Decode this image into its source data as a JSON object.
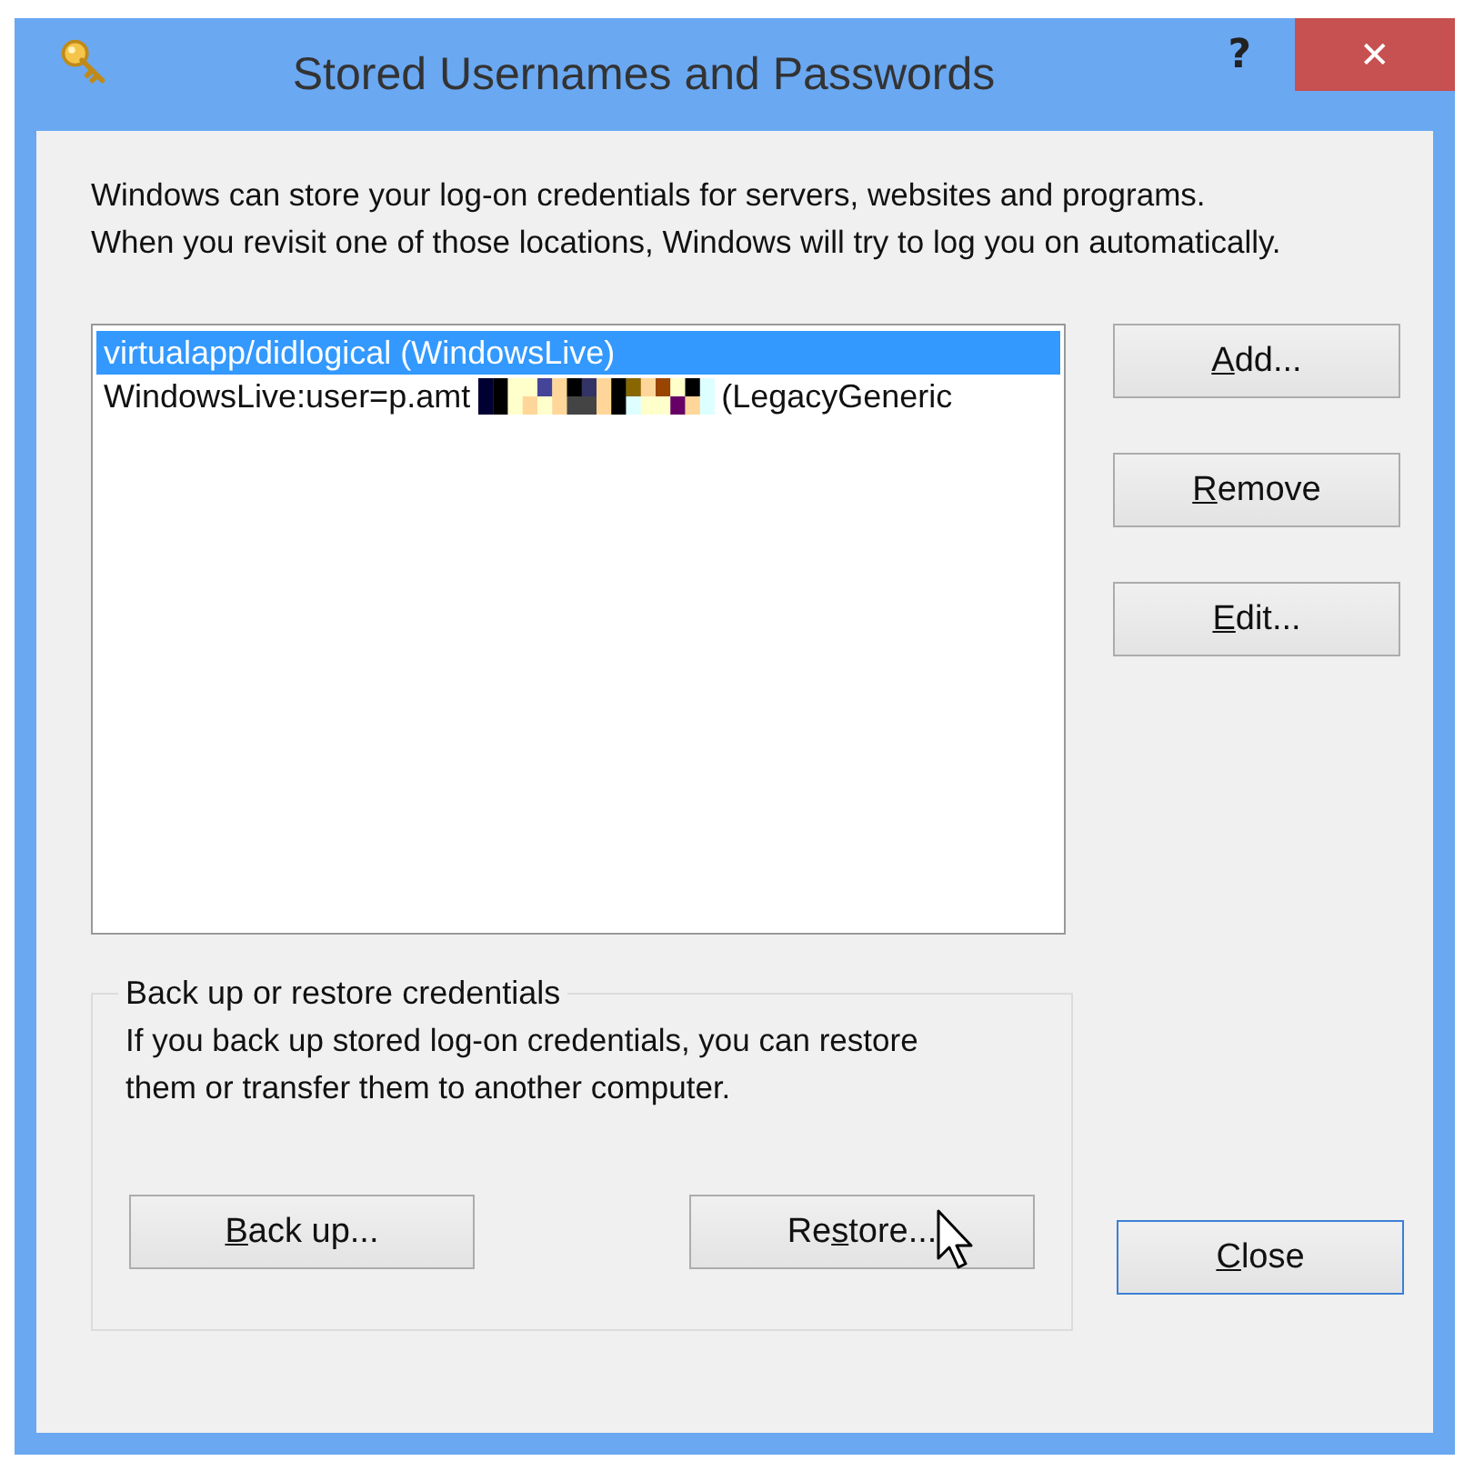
{
  "window": {
    "title": "Stored Usernames and Passwords",
    "help": "?",
    "close": "✕"
  },
  "intro": "Windows can store your log-on credentials for servers, websites and programs. When you revisit one of those locations, Windows will try to log you on automatically.",
  "credentials": [
    {
      "text": "virtualapp/didlogical (WindowsLive)",
      "selected": true,
      "redacted": false
    },
    {
      "text": "WindowsLive:user=p.amt",
      "suffix": "(LegacyGeneric",
      "selected": false,
      "redacted": true
    }
  ],
  "side_buttons": [
    {
      "access_key": "A",
      "after": "dd..."
    },
    {
      "access_key": "R",
      "after": "emove"
    },
    {
      "access_key": "E",
      "after": "dit..."
    }
  ],
  "backup": {
    "title": "Back up or restore credentials",
    "text": "If you back up stored log-on credentials, you can restore them or transfer them to another computer.",
    "buttons": [
      {
        "access_key": "B",
        "after": "ack up..."
      },
      {
        "before": "Re",
        "access_key": "s",
        "after": "tore..."
      }
    ]
  },
  "close_button": {
    "access_key": "C",
    "after": "lose",
    "focused": true
  }
}
